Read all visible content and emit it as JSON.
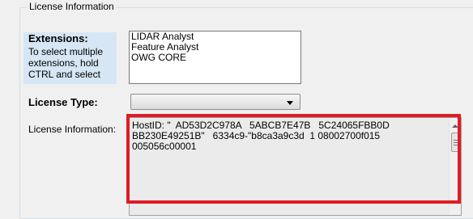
{
  "group": {
    "title": "License Information"
  },
  "extensions": {
    "title": "Extensions:",
    "hint": "To select multiple extensions, hold CTRL and select",
    "items": [
      "LIDAR Analyst",
      "Feature Analyst",
      "OWG CORE"
    ]
  },
  "license_type": {
    "label": "License Type:",
    "value": ""
  },
  "license_info": {
    "label": "License Information:",
    "text": "HostID: \"  AD53D2C978A   5ABCB7E47B   5C24065FBB0D\nBB230E49251B\"   6334c9-\"b8ca3a9c3d  1 08002700f015\n005056c00001"
  },
  "annotation": {
    "color": "#e01b24"
  }
}
